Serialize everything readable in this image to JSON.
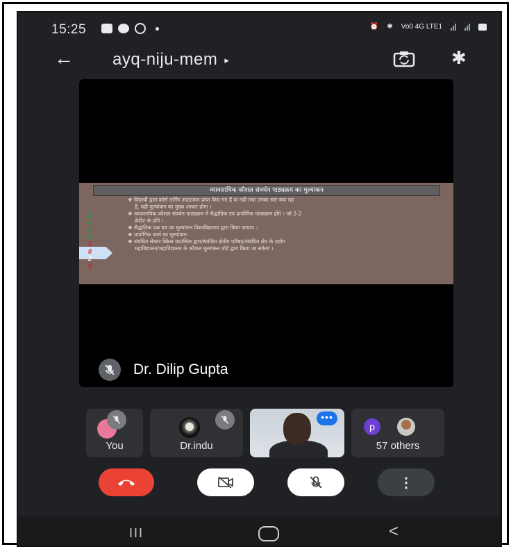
{
  "status_bar": {
    "time": "15:25",
    "network_text": "Vo0 4G LTE1"
  },
  "top_bar": {
    "meeting_code": "ayq-niju-mem",
    "caret": "▸",
    "back_icon": "arrow-left-icon",
    "switch_camera_icon": "switch-camera-icon",
    "bluetooth_icon": "bluetooth-icon"
  },
  "presentation": {
    "slide": {
      "title": "व्यावसायिक कौशल संवर्धन पाठ्यक्रम का मूल्यांकन",
      "lines": [
        "❖ विद्यार्थी द्वारा कोर्स लर्निंग आउटकम प्राप्त किए गए हैं या नहीं तथा उनका स्तर क्या रहा",
        "है, यही मूल्यांकन का मुख्य आधार होगा ।",
        "❖ व्यावसायिक कौशल संवर्धन पाठ्यक्रम में सैद्धांतिक एवं प्रायोगिक पाठ्यक्रम होंगे । जो 2-2",
        "क्रेडिट के होंगे ।",
        "❖ सैद्धांतिक प्रश्न पत्र का मूल्यांकन विश्वविद्यालय द्वारा किया जायगा ।",
        "❖ प्रायोगिक कार्य का मूल्यांकन-",
        "❖ संबंधित सेक्टर स्किल काउंसिल द्वारा/संबंधित क्षेत्रीय परिषद/संबंधित क्षेत्र के उद्योग",
        "महाविद्यालय/महाविद्यालय के कौशल मूल्यांकन बोर्ड द्वारा किया जा सकेगा ।"
      ],
      "year_digits": [
        "2",
        "0",
        "2",
        "0",
        "2",
        "0",
        "2",
        "0"
      ]
    },
    "presenter_name": "Dr. Dilip Gupta"
  },
  "participants": {
    "you_label": "You",
    "indu_label": "Dr.indu",
    "others_label": "57 others",
    "others_initial": "p",
    "speaking_indicator": "•••"
  },
  "controls": {
    "end_call_icon": "hang-up-icon",
    "camera_icon": "camera-off-icon",
    "mic_icon": "mic-off-icon",
    "more_label": "⋮"
  },
  "navigation": {
    "recent_label": "III",
    "back_label": "<"
  },
  "colors": {
    "end_call": "#ea4335",
    "slide_bg": "#7d6560",
    "speaking": "#1a73e8",
    "others_avatar": "#6e3fd4",
    "year_green": "#1e9e3a",
    "year_red": "#d42020",
    "year_white": "#ffffff"
  }
}
